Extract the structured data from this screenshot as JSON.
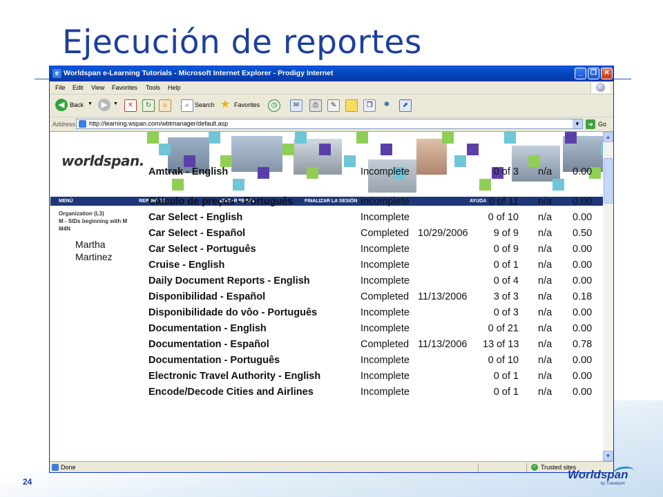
{
  "slide": {
    "title": "Ejecución de reportes",
    "page_number": "24",
    "footer_logo": "Worldspan",
    "footer_logo_sub": "by Travelport"
  },
  "window": {
    "title": "Worldspan e-Learning Tutorials - Microsoft Internet Explorer - Prodigy Internet",
    "controls": {
      "minimize": "_",
      "maximize": "❐",
      "close": "✕"
    }
  },
  "menu": [
    "File",
    "Edit",
    "View",
    "Favorites",
    "Tools",
    "Help"
  ],
  "toolbar": {
    "back": "Back",
    "search": "Search",
    "favorites": "Favorites"
  },
  "address": {
    "label": "Address",
    "url": "http://learning.wspan.com/wbtmanager/default.asp",
    "go": "Go"
  },
  "banner": {
    "logo": "worldspan."
  },
  "nav": [
    "MENÚ",
    "REPORTES",
    "EDITAR PERFIL",
    "FINALIZAR LA SESIÓN",
    "AYUDA"
  ],
  "org": {
    "line1": "Organization (L3)",
    "line2": "M - SIDs beginning with M",
    "line3": "M4N"
  },
  "person": {
    "first": "Martha",
    "last": "Martinez"
  },
  "rows": [
    {
      "course": "Amtrak - English",
      "status": "Incomplete",
      "date": "",
      "progress": "0 of 3",
      "na": "n/a",
      "score": "0.00"
    },
    {
      "course": "Cálculo de preços - Português",
      "status": "Incomplete",
      "date": "",
      "progress": "0 of 11",
      "na": "n/a",
      "score": "0.00"
    },
    {
      "course": "Car Select - English",
      "status": "Incomplete",
      "date": "",
      "progress": "0 of 10",
      "na": "n/a",
      "score": "0.00"
    },
    {
      "course": "Car Select - Español",
      "status": "Completed",
      "date": "10/29/2006",
      "progress": "9 of 9",
      "na": "n/a",
      "score": "0.50"
    },
    {
      "course": "Car Select - Português",
      "status": "Incomplete",
      "date": "",
      "progress": "0 of 9",
      "na": "n/a",
      "score": "0.00"
    },
    {
      "course": "Cruise - English",
      "status": "Incomplete",
      "date": "",
      "progress": "0 of 1",
      "na": "n/a",
      "score": "0.00"
    },
    {
      "course": "Daily Document Reports - English",
      "status": "Incomplete",
      "date": "",
      "progress": "0 of 4",
      "na": "n/a",
      "score": "0.00"
    },
    {
      "course": "Disponibilidad - Español",
      "status": "Completed",
      "date": "11/13/2006",
      "progress": "3 of 3",
      "na": "n/a",
      "score": "0.18"
    },
    {
      "course": "Disponibilidade do vôo - Português",
      "status": "Incomplete",
      "date": "",
      "progress": "0 of 3",
      "na": "n/a",
      "score": "0.00"
    },
    {
      "course": "Documentation - English",
      "status": "Incomplete",
      "date": "",
      "progress": "0 of 21",
      "na": "n/a",
      "score": "0.00"
    },
    {
      "course": "Documentation - Español",
      "status": "Completed",
      "date": "11/13/2006",
      "progress": "13 of 13",
      "na": "n/a",
      "score": "0.78"
    },
    {
      "course": "Documentation - Português",
      "status": "Incomplete",
      "date": "",
      "progress": "0 of 10",
      "na": "n/a",
      "score": "0.00"
    },
    {
      "course": "Electronic Travel Authority - English",
      "status": "Incomplete",
      "date": "",
      "progress": "0 of 1",
      "na": "n/a",
      "score": "0.00"
    },
    {
      "course": "Encode/Decode Cities and Airlines",
      "status": "Incomplete",
      "date": "",
      "progress": "0 of 1",
      "na": "n/a",
      "score": "0.00"
    }
  ],
  "statusbar": {
    "text": "Done",
    "zone": "Trusted sites"
  },
  "colors": {
    "title_blue": "#1d3f9c",
    "nav_bar": "#1e3778",
    "xp_blue": "#0542b8"
  }
}
